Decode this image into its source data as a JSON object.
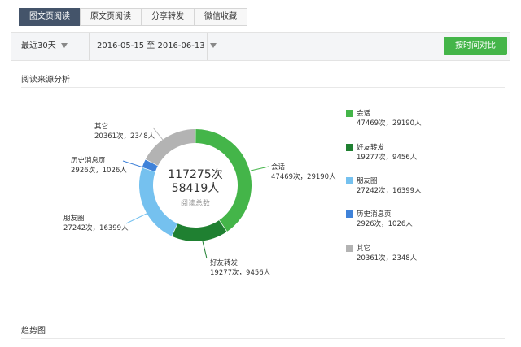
{
  "tabs": [
    "图文页阅读",
    "原文页阅读",
    "分享转发",
    "微信收藏"
  ],
  "active_tab": 0,
  "filter": {
    "period": "最近30天",
    "date_range": "2016-05-15 至 2016-06-13",
    "compare_button": "按时间对比"
  },
  "section_titles": {
    "source": "阅读来源分析",
    "trend": "趋势图"
  },
  "center": {
    "total_count": "117275次",
    "total_users": "58419人",
    "label": "阅读总数"
  },
  "chart_data": {
    "type": "pie",
    "donut": true,
    "categories": [
      "会话",
      "好友转发",
      "朋友圈",
      "历史消息页",
      "其它"
    ],
    "values": [
      47469,
      19277,
      27242,
      2926,
      20361
    ],
    "users": [
      29190,
      9456,
      16399,
      1026,
      2348
    ],
    "labels": [
      "47469次，29190人",
      "19277次，9456人",
      "27242次，16399人",
      "2926次，1026人",
      "20361次，2348人"
    ],
    "colors": [
      "#44b549",
      "#1f8031",
      "#75c1ef",
      "#3f82d9",
      "#b3b3b3"
    ],
    "legend_position": "right"
  },
  "colors": {
    "accent": "#44b549",
    "tab_active": "#44546a"
  }
}
